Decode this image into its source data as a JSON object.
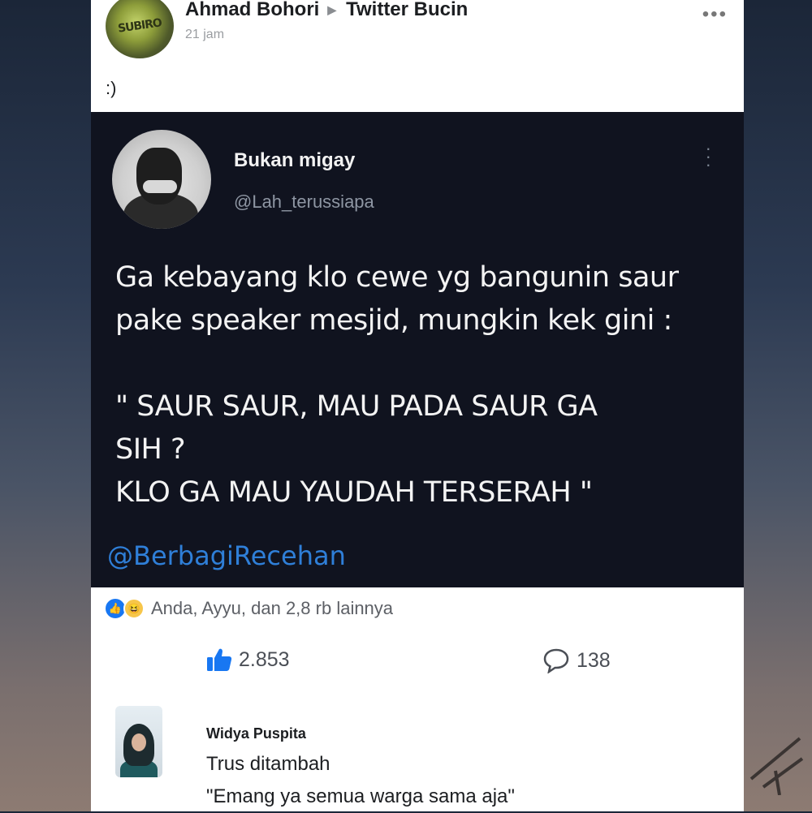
{
  "post": {
    "author": "Ahmad Bohori",
    "group": "Twitter Bucin",
    "time": "21 jam",
    "caption": ":)",
    "more_icon": "more-dots-icon"
  },
  "tweet": {
    "name": "Bukan migay",
    "handle": "@Lah_terussiapa",
    "lines": [
      "Ga kebayang klo cewe yg bangunin saur",
      "pake speaker mesjid, mungkin kek gini :"
    ],
    "quote_lines": [
      "\" SAUR SAUR, MAU PADA SAUR GA",
      "SIH ?",
      "KLO GA MAU YAUDAH TERSERAH \""
    ],
    "watermark": "@BerbagiRecehan"
  },
  "reactions": {
    "summary": "Anda, Ayyu, dan 2,8 rb lainnya",
    "likes": "2.853",
    "comments": "138",
    "colors": {
      "like": "#1877f2",
      "haha": "#f7c64a"
    }
  },
  "comment": {
    "author": "Widya Puspita",
    "lines": [
      "Trus ditambah",
      "\"Emang ya semua warga sama aja\""
    ]
  }
}
